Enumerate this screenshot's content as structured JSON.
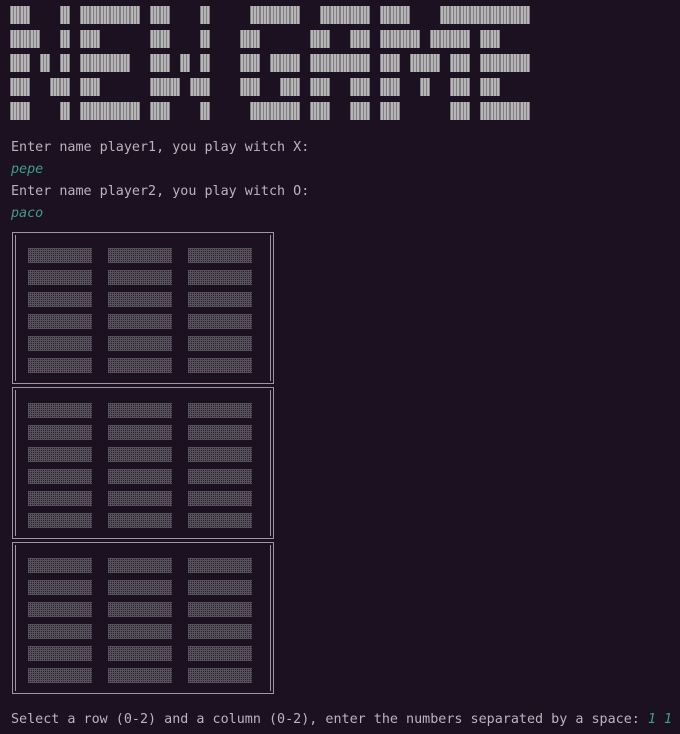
{
  "terminal": {
    "prompt1": "Enter name player1, you play witch X:",
    "input1": "pepe",
    "prompt2": "Enter name player2, you play witch O:",
    "input2": "paco",
    "move_prompt": "Select a row (0-2) and a column (0-2), enter the numbers separated by a space: ",
    "move_input": "1 1"
  },
  "board": {
    "sections": 3,
    "rows_per_section": 6,
    "columns": 3
  },
  "colors": {
    "background": "#1b1120",
    "text": "#b9b4bd",
    "user_input": "#3f9d8a"
  }
}
